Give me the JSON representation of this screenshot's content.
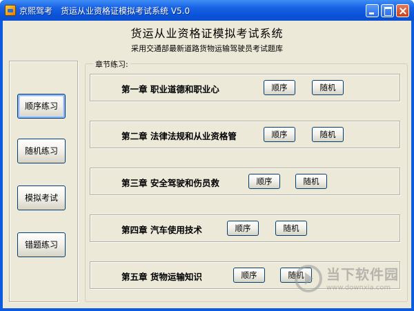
{
  "window": {
    "app_name": "京熙驾考",
    "title": "货运从业资格证模拟考试系统 V5.0"
  },
  "header": {
    "title": "货运从业资格证模拟考试系统",
    "subtitle": "采用交通部最新道路货物运输驾驶员考试题库"
  },
  "sidebar": {
    "items": [
      {
        "label": "顺序练习"
      },
      {
        "label": "随机练习"
      },
      {
        "label": "模拟考试"
      },
      {
        "label": "错题练习"
      }
    ]
  },
  "chapters_group": {
    "legend": "章节练习:",
    "chapters": [
      {
        "label": "第一章 职业道德和职业心",
        "sequential": "顺序",
        "random": "随机"
      },
      {
        "label": "第二章 法律法规和从业资格管",
        "sequential": "顺序",
        "random": "随机"
      },
      {
        "label": "第三章 安全驾驶和伤员救",
        "sequential": "顺序",
        "random": "随机"
      },
      {
        "label": "第四章 汽车使用技术",
        "sequential": "顺序",
        "random": "随机"
      },
      {
        "label": "第五章 货物运输知识",
        "sequential": "顺序",
        "random": "随机"
      }
    ]
  },
  "watermark": {
    "name": "当下软件园",
    "url": "www.downxia.com"
  },
  "colors": {
    "titlebar": "#0b5ae0",
    "client_bg": "#ece9d8",
    "button_border": "#003c74"
  }
}
